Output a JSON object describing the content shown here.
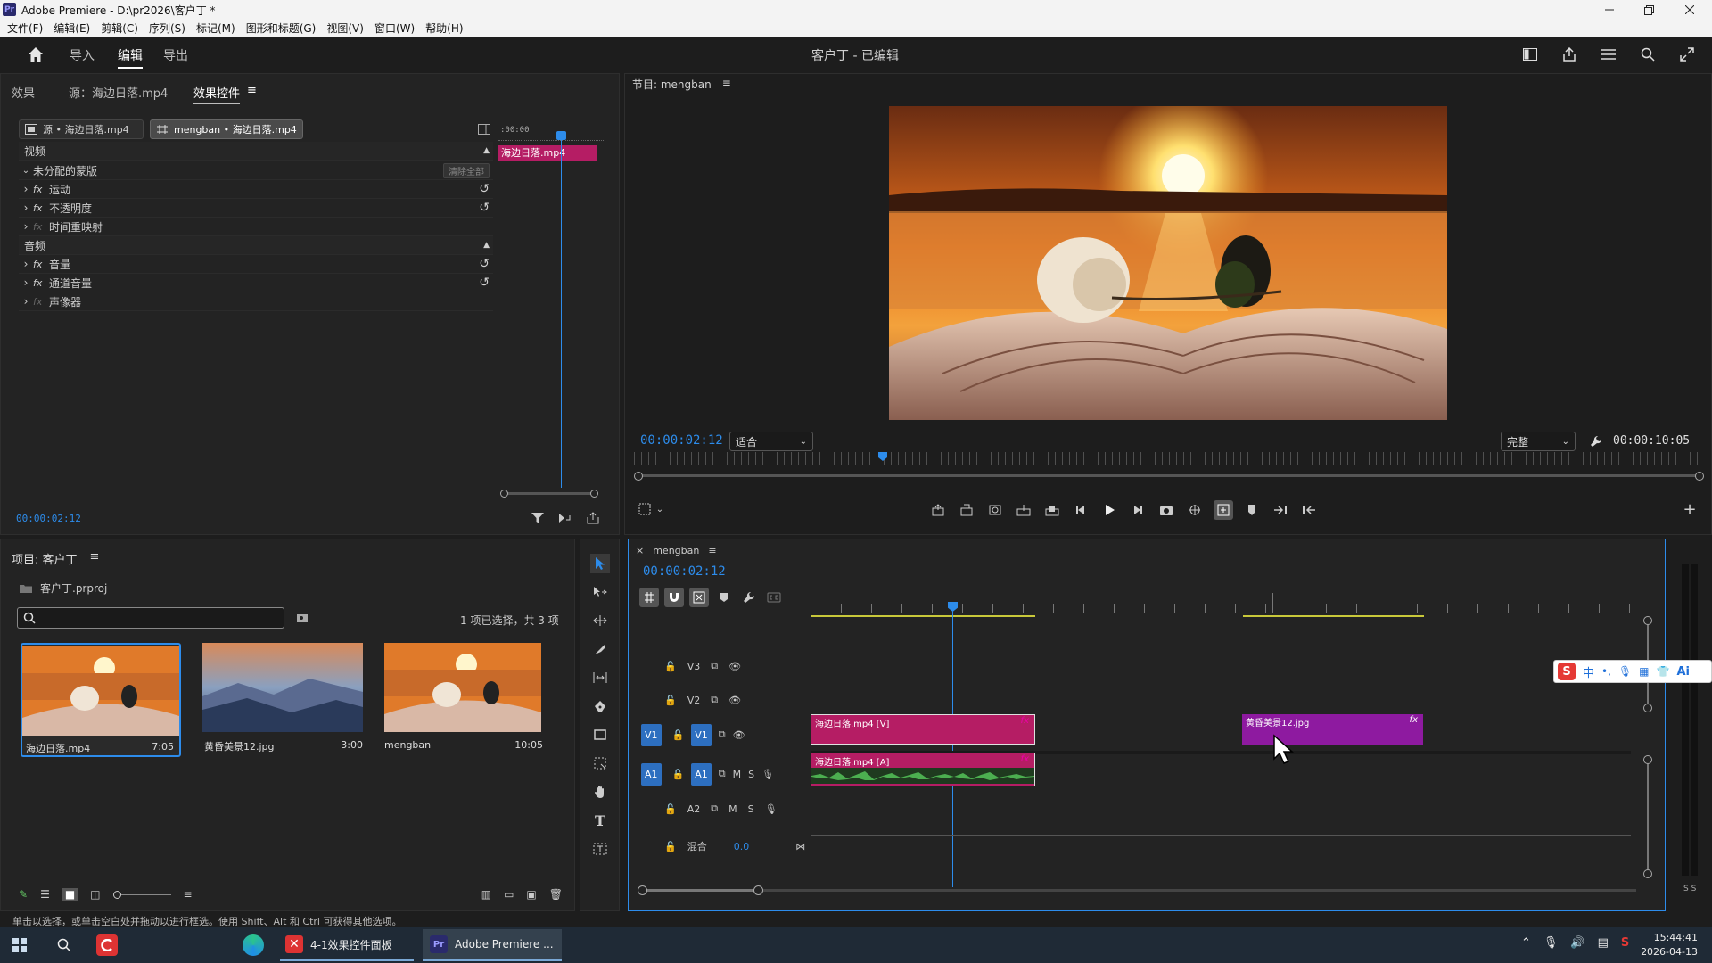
{
  "titlebar": {
    "app_icon": "Pr",
    "title": "Adobe Premiere - D:\\pr2026\\客户丁 *"
  },
  "menubar": [
    "文件(F)",
    "编辑(E)",
    "剪辑(C)",
    "序列(S)",
    "标记(M)",
    "图形和标题(G)",
    "视图(V)",
    "窗口(W)",
    "帮助(H)"
  ],
  "workspace": {
    "tabs": [
      "导入",
      "编辑",
      "导出"
    ],
    "active_tab": "编辑",
    "center_title": "客户丁 - 已编辑"
  },
  "effect_controls": {
    "tabs": [
      "效果",
      "源：海边日落.mp4",
      "效果控件"
    ],
    "active_tab": "效果控件",
    "source_chip": "源 • 海边日落.mp4",
    "seq_chip": "mengban • 海边日落.mp4",
    "mini_timecode": ":00:00",
    "mini_clip": "海边日落.mp4",
    "video_header": "视频",
    "mask_row": "未分配的蒙版",
    "clear_all": "清除全部",
    "video_effects": [
      "运动",
      "不透明度",
      "时间重映射"
    ],
    "audio_header": "音频",
    "audio_effects": [
      "音量",
      "通道音量",
      "声像器"
    ],
    "timecode": "00:00:02:12"
  },
  "program_monitor": {
    "title": "节目: mengban",
    "timecode": "00:00:02:12",
    "fit_value": "适合",
    "quality_value": "完整",
    "duration": "00:00:10:05"
  },
  "project": {
    "title": "项目: 客户丁",
    "file": "客户丁.prproj",
    "search_placeholder": "",
    "selection_status": "1 项已选择，共 3 项",
    "items": [
      {
        "name": "海边日落.mp4",
        "duration": "7:05"
      },
      {
        "name": "黄昏美景12.jpg",
        "duration": "3:00"
      },
      {
        "name": "mengban",
        "duration": "10:05"
      }
    ]
  },
  "timeline": {
    "sequence": "mengban",
    "timecode": "00:00:02:12",
    "tracks_video": [
      "V3",
      "V2",
      "V1"
    ],
    "tracks_audio": [
      "A1",
      "A2"
    ],
    "src_v": "V1",
    "src_a": "A1",
    "mix_label": "混合",
    "mix_value": "0.0",
    "btn_m": "M",
    "btn_s": "S",
    "clips": {
      "v1_a": "海边日落.mp4 [V]",
      "v1_b": "黄昏美景12.jpg",
      "a1": "海边日落.mp4 [A]",
      "fx": "fx"
    },
    "meter_label": "S S"
  },
  "ime": {
    "logo": "S",
    "items": [
      "中",
      "•,"
    ],
    "ai": "Ai"
  },
  "statusbar": "单击以选择，或单击空白处并拖动以进行框选。使用 Shift、Alt 和 Ctrl 可获得其他选项。",
  "taskbar": {
    "apps": [
      {
        "label": "4-1效果控件面板"
      },
      {
        "label": "Adobe Premiere ..."
      }
    ],
    "time": "15:44:41",
    "date": "2026-04-13"
  },
  "colors": {
    "accent": "#2d8ceb",
    "video_clip": "#b51d64",
    "image_clip": "#8e1aa0",
    "audio_clip": "#b51d64",
    "waveform": "#4caf50"
  }
}
